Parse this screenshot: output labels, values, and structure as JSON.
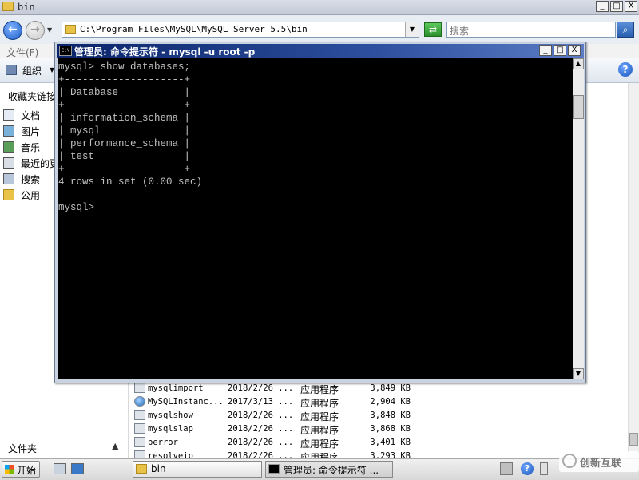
{
  "explorer": {
    "title": "bin",
    "address": "C:\\Program Files\\MySQL\\MySQL Server 5.5\\bin",
    "search_placeholder": "搜索",
    "menu_file": "文件(F)",
    "organize": "组织",
    "sidebar_heading": "收藏夹链接",
    "sidebar_items": [
      "文档",
      "图片",
      "音乐",
      "最近的更",
      "搜索",
      "公用"
    ],
    "folders_label": "文件夹",
    "files": [
      {
        "name": "mysqlimport",
        "date": "2018/2/26 ...",
        "type": "应用程序",
        "size": "3,849 KB"
      },
      {
        "name": "MySQLInstanc...",
        "date": "2017/3/13 ...",
        "type": "应用程序",
        "size": "2,904 KB"
      },
      {
        "name": "mysqlshow",
        "date": "2018/2/26 ...",
        "type": "应用程序",
        "size": "3,848 KB"
      },
      {
        "name": "mysqlslap",
        "date": "2018/2/26 ...",
        "type": "应用程序",
        "size": "3,868 KB"
      },
      {
        "name": "perror",
        "date": "2018/2/26 ...",
        "type": "应用程序",
        "size": "3,401 KB"
      },
      {
        "name": "resolveip",
        "date": "2018/2/26 ...",
        "type": "应用程序",
        "size": "3,293 KB"
      }
    ]
  },
  "cmd": {
    "title": "管理员: 命令提示符 - mysql  -u root -p",
    "output": "mysql> show databases;\n+--------------------+\n| Database           |\n+--------------------+\n| information_schema |\n| mysql              |\n| performance_schema |\n| test               |\n+--------------------+\n4 rows in set (0.00 sec)\n\nmysql>"
  },
  "taskbar": {
    "start": "开始",
    "tasks": [
      "bin",
      "管理员: 命令提示符 ..."
    ]
  },
  "watermark": "创新互联",
  "window_buttons": [
    "_",
    "□",
    "X"
  ],
  "colors": {
    "title_blue": "#0a246a",
    "console_bg": "#000000",
    "console_fg": "#c0c0c0"
  }
}
